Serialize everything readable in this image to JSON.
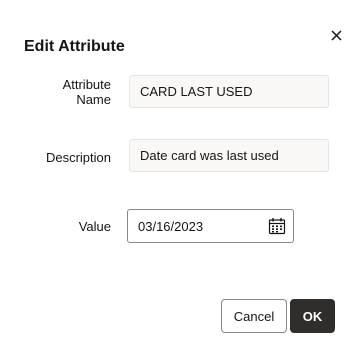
{
  "dialog": {
    "title": "Edit Attribute",
    "close_icon": "close-icon"
  },
  "form": {
    "attribute_name_label_line1": "Attribute",
    "attribute_name_label_line2": "Name",
    "attribute_name_value": "CARD LAST USED",
    "description_label": "Description",
    "description_value": "Date card was last used",
    "value_label": "Value",
    "value_date": "03/16/2023",
    "calendar_icon": "calendar-icon"
  },
  "footer": {
    "cancel_label": "Cancel",
    "ok_label": "OK"
  }
}
